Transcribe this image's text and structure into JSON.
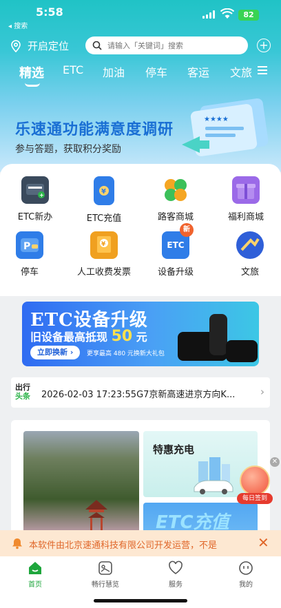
{
  "status": {
    "time": "5:58",
    "back_label": "◂ 搜索",
    "battery": "82"
  },
  "header": {
    "location_label": "开启定位",
    "search_placeholder": "请输入「关键词」搜索"
  },
  "tabs": [
    "精选",
    "ETC",
    "加油",
    "停车",
    "客运",
    "文旅"
  ],
  "survey": {
    "title": "乐速通功能满意度调研",
    "subtitle": "参与答题，获取积分奖励"
  },
  "grid": [
    {
      "label": "ETC新办",
      "icon": "etc-card-icon",
      "color": "#3a4a5c"
    },
    {
      "label": "ETC充值",
      "icon": "phone-recharge-icon",
      "color": "#2f7de8"
    },
    {
      "label": "路客商城",
      "icon": "clover-icon",
      "color": "#f0a020"
    },
    {
      "label": "福利商城",
      "icon": "gift-box-icon",
      "color": "#9b6ae8"
    },
    {
      "label": "停车",
      "icon": "parking-icon",
      "color": "#2f7de8"
    },
    {
      "label": "人工收费发票",
      "icon": "invoice-icon",
      "color": "#f0a020"
    },
    {
      "label": "设备升级",
      "icon": "device-upgrade-icon",
      "color": "#2f7de8",
      "badge": "新"
    },
    {
      "label": "文旅",
      "icon": "travel-icon",
      "color": "#2f5fd8"
    }
  ],
  "etc_banner": {
    "title": "ETC设备升级",
    "line": "旧设备最高抵现",
    "amount": "50",
    "unit": "元",
    "button": "立即换新 ›",
    "note": "更享最高 480 元换新大礼包"
  },
  "news": {
    "logo_a": "出行",
    "logo_b": "头条",
    "text": "2026-02-03 17:23:55G7京新高速进京方向K..."
  },
  "promo": {
    "charge_label": "特惠充电",
    "etc_value_label": "ETC充值"
  },
  "checkin": {
    "label": "每日签到"
  },
  "notice": {
    "text": "本软件由北京速通科技有限公司开发运营，不是"
  },
  "nav": [
    "首页",
    "畅行慧览",
    "服务",
    "我的"
  ]
}
